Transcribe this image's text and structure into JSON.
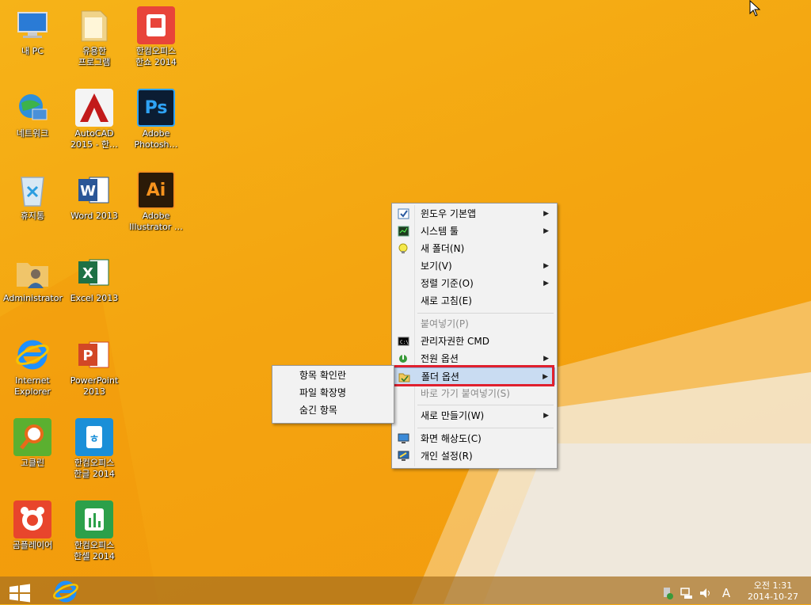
{
  "desktop_icons": [
    {
      "label": "내 PC",
      "icon": "computer-icon"
    },
    {
      "label": "유용한\n프로그램",
      "icon": "folder-icon"
    },
    {
      "label": "한컴오피스\n한쇼 2014",
      "icon": "hanshow-icon"
    },
    {
      "label": "네트워크",
      "icon": "network-icon"
    },
    {
      "label": "AutoCAD\n2015 - 한…",
      "icon": "autocad-icon"
    },
    {
      "label": "Adobe\nPhotosh…",
      "icon": "photoshop-icon"
    },
    {
      "label": "휴지통",
      "icon": "recycle-bin-icon"
    },
    {
      "label": "Word 2013",
      "icon": "word-icon"
    },
    {
      "label": "Adobe\nIllustrator …",
      "icon": "illustrator-icon"
    },
    {
      "label": "Administrator",
      "icon": "user-folder-icon"
    },
    {
      "label": "Excel 2013",
      "icon": "excel-icon"
    },
    {
      "label": "Internet\nExplorer",
      "icon": "ie-icon"
    },
    {
      "label": "PowerPoint\n2013",
      "icon": "powerpoint-icon"
    },
    {
      "label": "고클린",
      "icon": "goclean-icon"
    },
    {
      "label": "한컴오피스\n한글 2014",
      "icon": "hangul-icon"
    },
    {
      "label": "곰플레이어",
      "icon": "gomplayer-icon"
    },
    {
      "label": "한컴오피스\n한셀 2014",
      "icon": "hancell-icon"
    }
  ],
  "context_menu": {
    "items": [
      {
        "label": "윈도우 기본앱",
        "has_submenu": true
      },
      {
        "label": "시스템 툴",
        "has_submenu": true
      },
      {
        "label": "새 폴더(N)",
        "has_submenu": false
      },
      {
        "label": "보기(V)",
        "has_submenu": true
      },
      {
        "label": "정렬 기준(O)",
        "has_submenu": true
      },
      {
        "label": "새로 고침(E)",
        "has_submenu": false
      },
      {
        "label": "붙여넣기(P)",
        "disabled": true
      },
      {
        "label": "관리자권한 CMD",
        "has_submenu": false
      },
      {
        "label": "전원 옵션",
        "has_submenu": true
      },
      {
        "label": "폴더 옵션",
        "has_submenu": true,
        "highlighted": true
      },
      {
        "label": "바로 가기 붙여넣기(S)",
        "disabled": true
      },
      {
        "label": "새로 만들기(W)",
        "has_submenu": true
      },
      {
        "label": "화면 해상도(C)",
        "has_submenu": false
      },
      {
        "label": "개인 설정(R)",
        "has_submenu": false
      }
    ]
  },
  "submenu": {
    "items": [
      "항목 확인란",
      "파일 확장명",
      "숨긴 항목"
    ]
  },
  "taskbar": {
    "clock_time": "오전 1:31",
    "clock_date": "2014-10-27",
    "ime_indicator": "A"
  },
  "colors": {
    "highlight_box": "#e0202e",
    "wallpaper": "#f4a510"
  }
}
